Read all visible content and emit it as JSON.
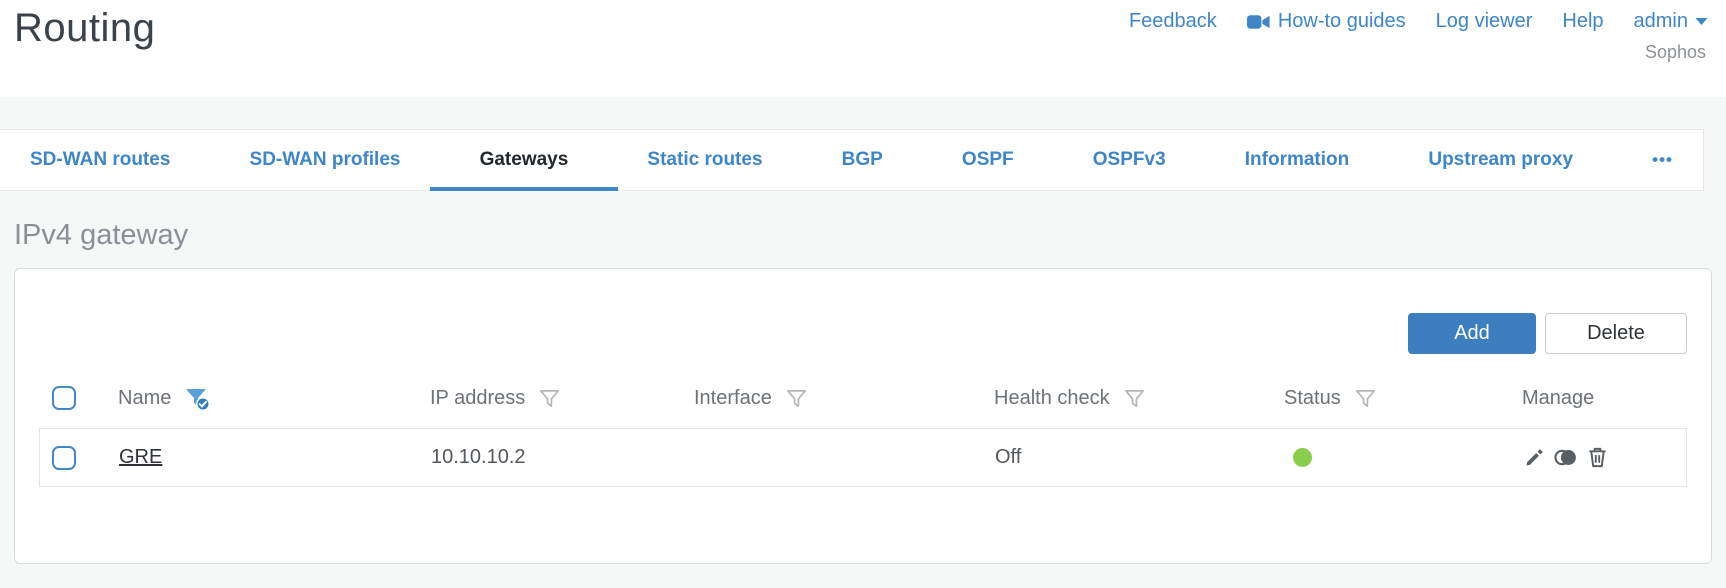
{
  "header": {
    "title": "Routing",
    "nav": {
      "feedback": "Feedback",
      "howto_guides": "How-to guides",
      "log_viewer": "Log viewer",
      "help": "Help",
      "user": "admin",
      "brand": "Sophos"
    }
  },
  "tabs": {
    "items": [
      {
        "label": "SD-WAN routes",
        "active": false
      },
      {
        "label": "SD-WAN profiles",
        "active": false
      },
      {
        "label": "Gateways",
        "active": true
      },
      {
        "label": "Static routes",
        "active": false
      },
      {
        "label": "BGP",
        "active": false
      },
      {
        "label": "OSPF",
        "active": false
      },
      {
        "label": "OSPFv3",
        "active": false
      },
      {
        "label": "Information",
        "active": false
      },
      {
        "label": "Upstream proxy",
        "active": false
      }
    ],
    "overflow": "•••"
  },
  "content": {
    "section_title": "IPv4 gateway",
    "toolbar": {
      "add": "Add",
      "delete": "Delete"
    },
    "table": {
      "columns": [
        "Name",
        "IP address",
        "Interface",
        "Health check",
        "Status",
        "Manage"
      ],
      "name_filter_state": "active",
      "other_filter_state": "inactive",
      "rows": [
        {
          "name": "GRE",
          "ip": "10.10.10.2",
          "interface": "",
          "health_check": "Off",
          "status": "up",
          "manage_icons": [
            "edit-icon",
            "clone-icon",
            "delete-icon"
          ]
        }
      ]
    }
  },
  "colors": {
    "accent_blue": "#3e86c8",
    "button_blue": "#3d7ebf",
    "status_green": "#8bce4b",
    "active_tab_text": "#23282d",
    "section_title_gray": "#8b9096"
  }
}
